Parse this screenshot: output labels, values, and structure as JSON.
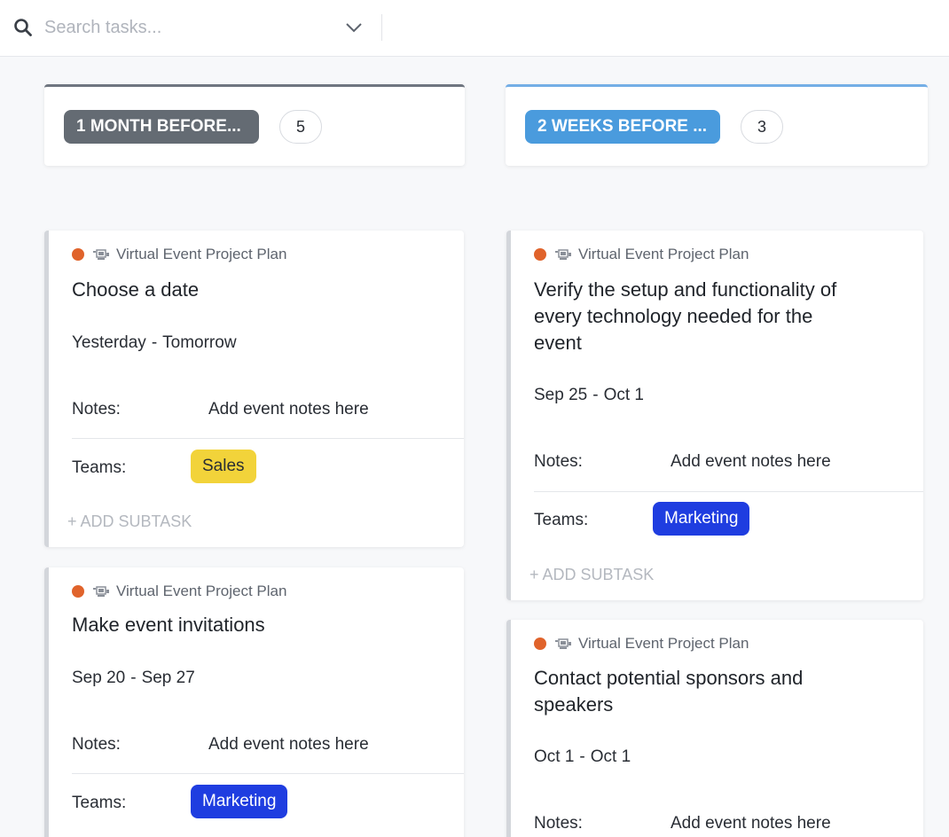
{
  "search": {
    "placeholder": "Search tasks..."
  },
  "columns": [
    {
      "status_label": "1 MONTH BEFORE...",
      "count": "5",
      "accent_color": "#6f7680",
      "cards": [
        {
          "project": "Virtual Event Project Plan",
          "title": "Choose a date",
          "date_start": "Yesterday",
          "date_sep": "-",
          "date_end": "Tomorrow",
          "notes_label": "Notes:",
          "notes_value": "Add event notes here",
          "teams_label": "Teams:",
          "team": "Sales",
          "team_color": "#f2d33a",
          "add_subtask": "+ ADD SUBTASK"
        },
        {
          "project": "Virtual Event Project Plan",
          "title": "Make event invitations",
          "date_start": "Sep 20",
          "date_sep": "-",
          "date_end": "Sep 27",
          "notes_label": "Notes:",
          "notes_value": "Add event notes here",
          "teams_label": "Teams:",
          "team": "Marketing",
          "team_color": "#1f3de0"
        }
      ]
    },
    {
      "status_label": "2 WEEKS BEFORE ...",
      "count": "3",
      "accent_color": "#74aee6",
      "cards": [
        {
          "project": "Virtual Event Project Plan",
          "title_lines": [
            "Verify the setup and functionality of",
            "every technology needed for the",
            "event"
          ],
          "date_start": "Sep 25",
          "date_sep": "-",
          "date_end": "Oct 1",
          "notes_label": "Notes:",
          "notes_value": "Add event notes here",
          "teams_label": "Teams:",
          "team": "Marketing",
          "team_color": "#1f3de0",
          "add_subtask": "+ ADD SUBTASK"
        },
        {
          "project": "Virtual Event Project Plan",
          "title_lines": [
            "Contact potential sponsors and",
            "speakers"
          ],
          "date_start": "Oct 1",
          "date_sep": "-",
          "date_end": "Oct 1",
          "notes_label": "Notes:",
          "notes_value": "Add event notes here"
        }
      ]
    }
  ]
}
